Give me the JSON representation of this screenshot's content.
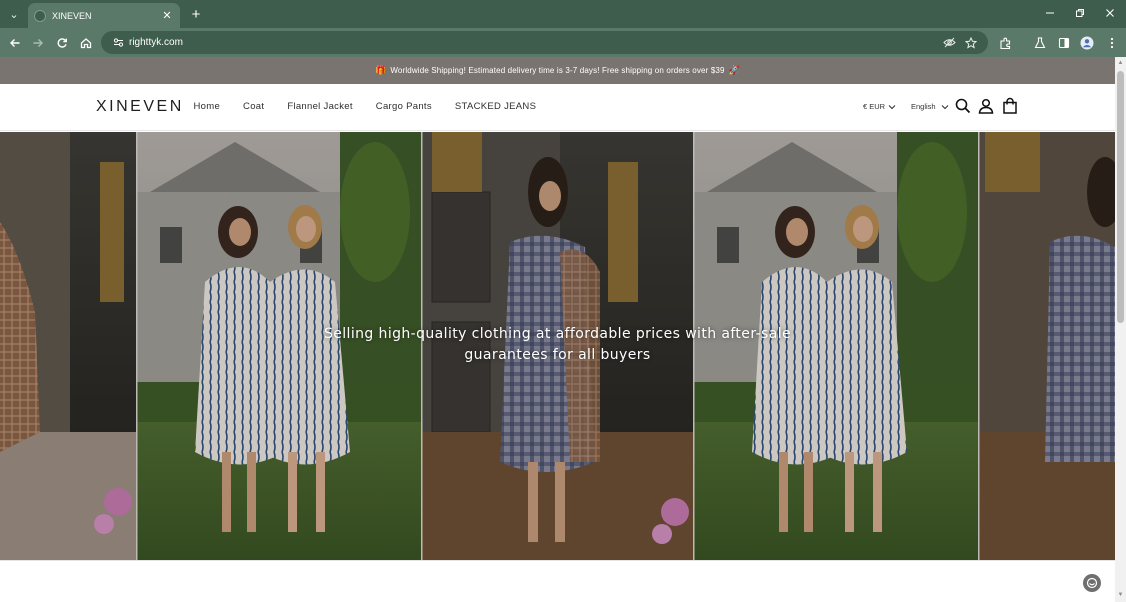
{
  "browser": {
    "tab_title": "XINEVEN",
    "url": "righttyk.com"
  },
  "announcement": {
    "emoji_left": "🎁",
    "text": "Worldwide Shipping! Estimated delivery time is 3-7 days! Free shipping on orders over $39",
    "emoji_right": "🚀"
  },
  "header": {
    "logo": "XINEVEN",
    "menu": [
      "Home",
      "Coat",
      "Flannel Jacket",
      "Cargo Pants",
      "STACKED JEANS"
    ],
    "currency": "€ EUR",
    "language": "English"
  },
  "hero": {
    "tagline": "Selling high-quality clothing at affordable prices with after-sale guarantees for all buyers"
  },
  "icons": {
    "search": "search-icon",
    "account": "account-icon",
    "cart": "cart-icon",
    "chat": "chat-icon"
  },
  "colors": {
    "tabbar": "#3e5d4d",
    "toolbar": "#5b7968",
    "announcement_bg": "#7a7470"
  }
}
